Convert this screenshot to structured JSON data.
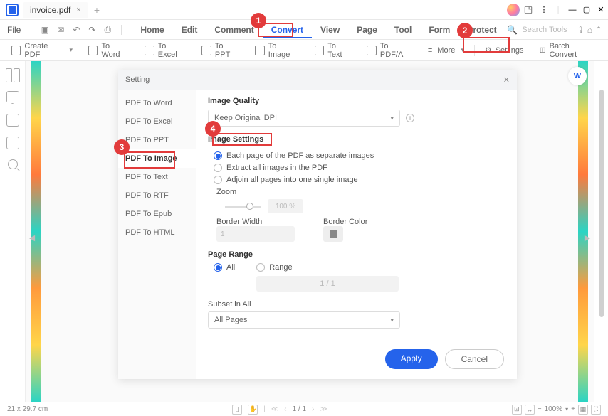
{
  "titlebar": {
    "filename": "invoice.pdf"
  },
  "menu": {
    "file": "File",
    "tabs": [
      "Home",
      "Edit",
      "Comment",
      "Convert",
      "View",
      "Page",
      "Tool",
      "Form",
      "Protect"
    ],
    "active": 3,
    "search_placeholder": "Search Tools"
  },
  "ribbon": {
    "items": [
      "Create PDF",
      "To Word",
      "To Excel",
      "To PPT",
      "To Image",
      "To Text",
      "To PDF/A",
      "More"
    ],
    "settings": "Settings",
    "batch": "Batch Convert"
  },
  "dialog": {
    "title": "Setting",
    "left": [
      "PDF To Word",
      "PDF To Excel",
      "PDF To PPT",
      "PDF To Image",
      "PDF To Text",
      "PDF To RTF",
      "PDF To Epub",
      "PDF To HTML"
    ],
    "selected": 3,
    "quality_label": "Image Quality",
    "quality_value": "Keep Original DPI",
    "image_settings_label": "Image Settings",
    "opt1": "Each page of the PDF as separate images",
    "opt2": "Extract all images in the PDF",
    "opt3": "Adjoin all pages into one single image",
    "zoom_label": "Zoom",
    "zoom_value": "100 %",
    "borderw_label": "Border Width",
    "borderw_value": "1",
    "borderc_label": "Border Color",
    "page_range_label": "Page Range",
    "range_all": "All",
    "range_range": "Range",
    "range_text": "1 / 1",
    "subset_label": "Subset in All",
    "subset_value": "All Pages",
    "apply": "Apply",
    "cancel": "Cancel"
  },
  "status": {
    "dims": "21 x 29.7 cm",
    "page": "1 / 1",
    "zoom": "100%"
  }
}
